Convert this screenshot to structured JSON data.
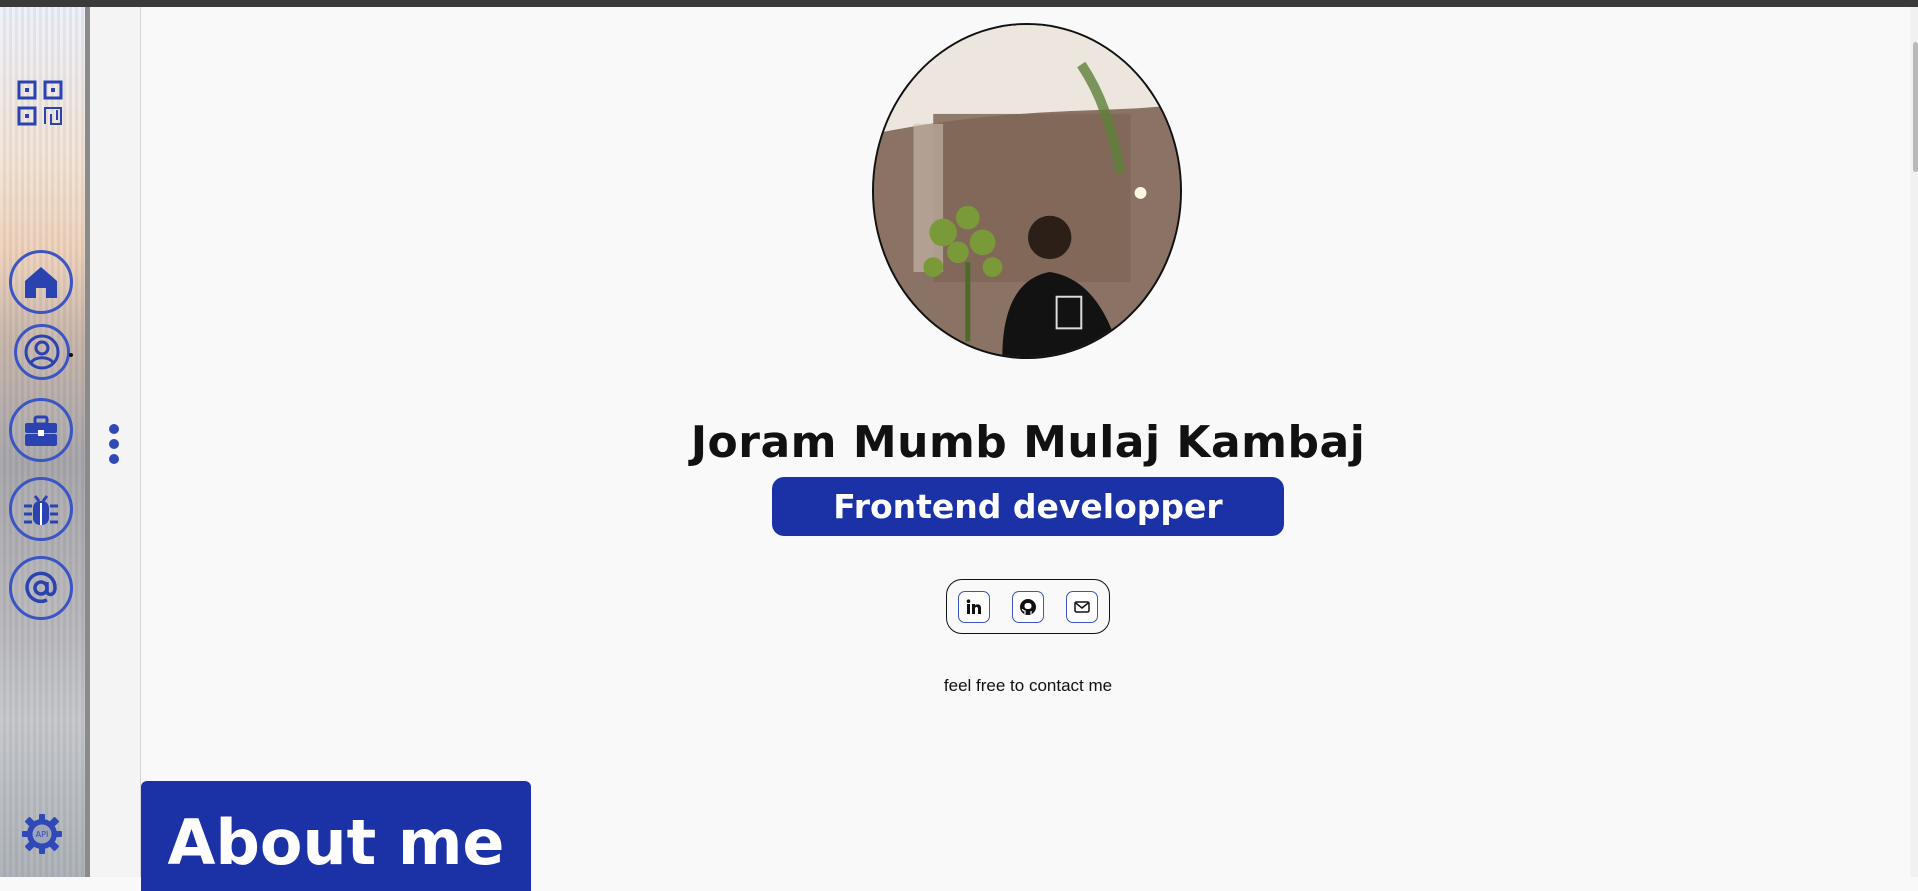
{
  "profile": {
    "name": "Joram Mumb Mulaj Kambaj",
    "role": "Frontend developper",
    "contact_text": "feel free to contact me"
  },
  "social": [
    "linkedin-icon",
    "github-icon",
    "mail-icon"
  ],
  "sidebar": {
    "items": [
      "home-icon",
      "user-icon",
      "briefcase-icon",
      "bug-icon",
      "at-icon"
    ],
    "settings_label": "API"
  },
  "section": {
    "about_title": "About me"
  },
  "colors": {
    "accent": "#1b31a6",
    "icon": "#3b55c4",
    "background": "#f9f9f9"
  }
}
